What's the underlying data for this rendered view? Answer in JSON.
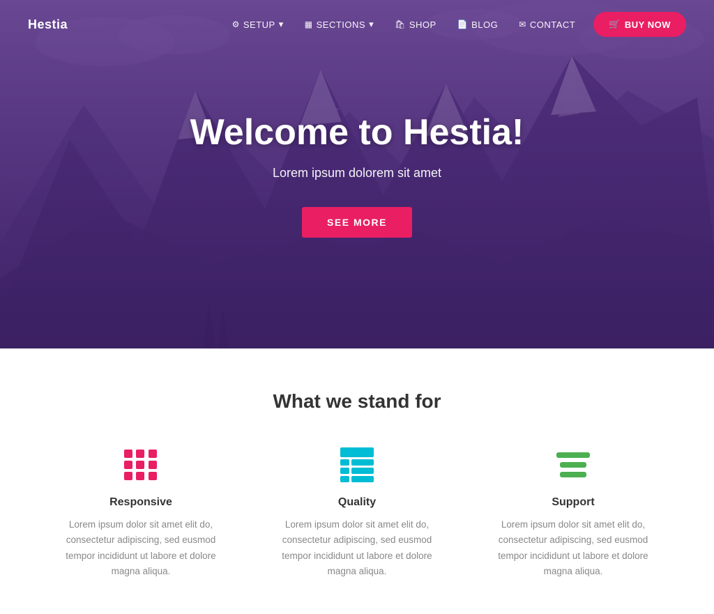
{
  "navbar": {
    "brand": "Hestia",
    "items": [
      {
        "label": "SETUP",
        "icon": "⚙",
        "hasDropdown": true
      },
      {
        "label": "SECTIONS",
        "icon": "▦",
        "hasDropdown": true
      },
      {
        "label": "SHOP",
        "icon": "🛍"
      },
      {
        "label": "BLOG",
        "icon": "📄"
      },
      {
        "label": "CONTACT",
        "icon": "✉"
      }
    ],
    "cta": {
      "label": "BUY NOW",
      "icon": "🛒"
    }
  },
  "hero": {
    "title": "Welcome to Hestia!",
    "subtitle": "Lorem ipsum dolorem sit amet",
    "cta_label": "SEE MORE"
  },
  "features": {
    "section_title": "What we stand for",
    "items": [
      {
        "id": "responsive",
        "label": "Responsive",
        "description": "Lorem ipsum dolor sit amet elit do, consectetur adipiscing, sed eusmod tempor incididunt ut labore et dolore magna aliqua.",
        "icon_type": "grid"
      },
      {
        "id": "quality",
        "label": "Quality",
        "description": "Lorem ipsum dolor sit amet elit do, consectetur adipiscing, sed eusmod tempor incididunt ut labore et dolore magna aliqua.",
        "icon_type": "table"
      },
      {
        "id": "support",
        "label": "Support",
        "description": "Lorem ipsum dolor sit amet elit do, consectetur adipiscing, sed eusmod tempor incididunt ut labore et dolore magna aliqua.",
        "icon_type": "lines"
      }
    ]
  },
  "colors": {
    "accent": "#e91e63",
    "teal": "#00bcd4",
    "green": "#4caf50",
    "dark": "#333333",
    "gray": "#888888"
  }
}
